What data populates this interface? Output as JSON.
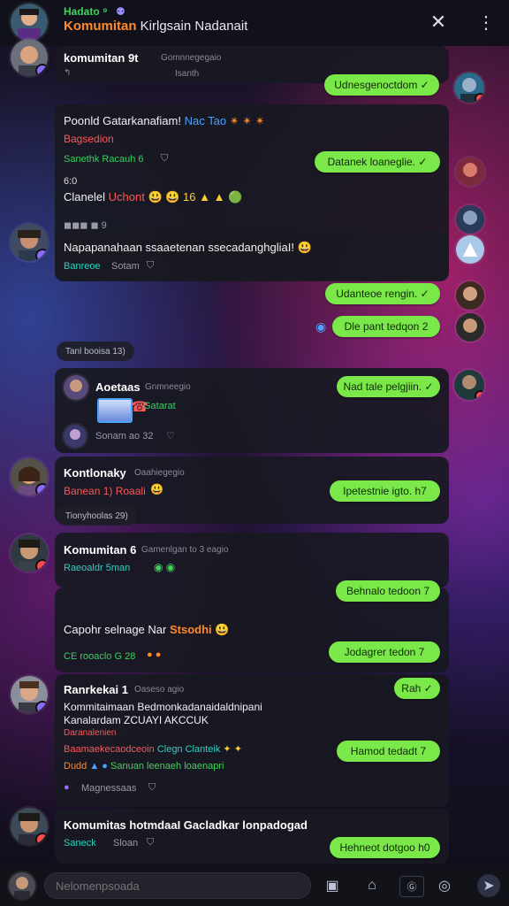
{
  "header": {
    "subtitle": "Hadato ⁹",
    "title_highlight": "Komumitan",
    "title_rest": " Kirlgsain Nadanait",
    "close_icon": "close-icon",
    "more_icon": "more-vertical-icon"
  },
  "messages": [
    {
      "name": "komumitan 9t",
      "time": "Gomnnegegaio",
      "subtime": "Isanth"
    },
    {
      "body": "Poonld Gatarkanafiam!",
      "body_link": "Nac Tao",
      "emoji": "✴ ✴ ✴",
      "red": "Bagsedion",
      "green": "Sanethk Racauh 6",
      "bold2": "6:0",
      "body2": "Clanelel",
      "body2_red": "Uchont",
      "emoji2": "😃 😃 16 ▲ ▲ 🟢",
      "icons_row": "◼◼◼ ◼ 9"
    },
    {
      "body": "Napapanahaan ssaaetenan ssecadanghgliaI!",
      "cyan": "Banreoe",
      "time": "Sotam"
    },
    {
      "pill": "Tanl booisa 13)"
    },
    {
      "name": "Aoetaas",
      "time": "Gnmneegio",
      "green": "Gatarat",
      "grey": "Sonam ao 32"
    },
    {
      "name": "Kontlonaky",
      "time": "Oaahiegegio",
      "red": "Banean 1) Roaali",
      "pill": "Tionyhoolas 29)"
    },
    {
      "name": "Komumitan 6",
      "time": "Gamenlgan to 3 eagio",
      "cyan": "Raeoaldr 5man"
    },
    {
      "body": "Capohr selnage Nar",
      "body_orange": "Stsodhi",
      "green": "CE rooaclo G 28"
    },
    {
      "name": "Ranrkekai 1",
      "time": "Oaseso agio",
      "line1": "Kommitaimaan Bedmonkadanaidaldnipani",
      "line2": "Kanalardam ZCUAYI AKCCUK",
      "red_small": "Daranalenien",
      "red_line": "Baamaekecaodceoin",
      "cyan_line": "Clegn Clanteik",
      "orange_line": "Dudd",
      "green_line": "Sanuan leenaeh loaenapri",
      "grey": "Magnessaas"
    },
    {
      "name": "Komumitas hotmdaaI Gacladkar lonpadogad",
      "cyan": "Saneck",
      "time": "Sloan"
    }
  ],
  "bubbles": [
    {
      "text": "Udnesgenoctdom ✓"
    },
    {
      "text": "Datanek loaneglie. ✓"
    },
    {
      "text": "Udanteoe rengin. ✓"
    },
    {
      "text": "Dle pant tedqon 2"
    },
    {
      "text": "Nad tale pelgjiin. ✓"
    },
    {
      "text": "Ipetestnie igto. h7"
    },
    {
      "text": "Behnalo tedoon 7"
    },
    {
      "text": "Jodagrer tedon 7"
    },
    {
      "text": "Rah ✓"
    },
    {
      "text": "Hamod tedadt 7"
    },
    {
      "text": "Hehneot dotgoo h0"
    }
  ],
  "composer": {
    "placeholder": "Nelomenpsoada"
  },
  "colors": {
    "accent_green": "#7be84a",
    "orange": "#ff8a2b",
    "red": "#ff5757",
    "cyan": "#2fd1c2",
    "brand_green": "#3fd35a"
  }
}
